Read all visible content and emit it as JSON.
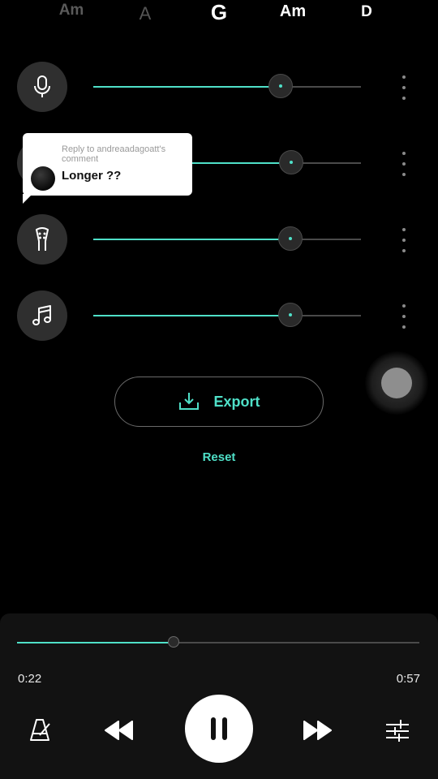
{
  "chords": [
    "Am",
    "A",
    "G",
    "Am",
    "D"
  ],
  "tracks": [
    {
      "icon": "microphone-icon",
      "level": 0.7
    },
    {
      "icon": "drums-icon",
      "level": 0.74
    },
    {
      "icon": "guitar-headstock-icon",
      "level": 0.735
    },
    {
      "icon": "music-note-icon",
      "level": 0.735
    }
  ],
  "comment_bubble": {
    "reply_to": "Reply to andreaadagoatt's comment",
    "text": "Longer ??"
  },
  "export": {
    "label": "Export",
    "icon": "download-icon"
  },
  "reset_label": "Reset",
  "player": {
    "current_time": "0:22",
    "total_time": "0:57",
    "progress": 0.39,
    "state": "playing"
  },
  "colors": {
    "accent": "#4fe0c8",
    "background": "#000000",
    "panel": "#121212"
  }
}
